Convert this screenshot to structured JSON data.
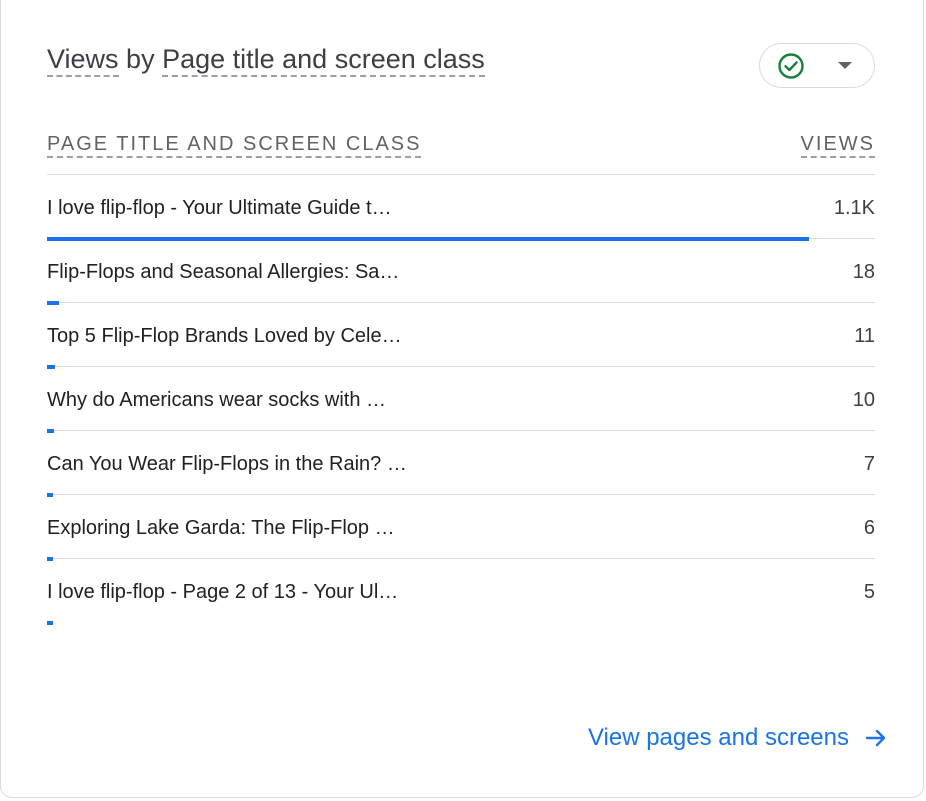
{
  "card": {
    "title_prefix": "Views",
    "title_mid": " by ",
    "title_dimension": "Page title and screen class",
    "status_icon": "check-circle-icon",
    "status_color": "#188038"
  },
  "table": {
    "col_left": "PAGE TITLE AND SCREEN CLASS",
    "col_right": "VIEWS",
    "bar_color": "#1a73e8",
    "max_views": 1100,
    "rows": [
      {
        "title": "I love flip-flop - Your Ultimate Guide t…",
        "value": "1.1K",
        "views": 1100
      },
      {
        "title": "Flip-Flops and Seasonal Allergies: Sa…",
        "value": "18",
        "views": 18
      },
      {
        "title": "Top 5 Flip-Flop Brands Loved by Cele…",
        "value": "11",
        "views": 11
      },
      {
        "title": "Why do Americans wear socks with …",
        "value": "10",
        "views": 10
      },
      {
        "title": "Can You Wear Flip-Flops in the Rain? …",
        "value": "7",
        "views": 7
      },
      {
        "title": "Exploring Lake Garda: The Flip-Flop …",
        "value": "6",
        "views": 6
      },
      {
        "title": "I love flip-flop - Page 2 of 13 - Your Ul…",
        "value": "5",
        "views": 5
      }
    ]
  },
  "footer": {
    "link_label": "View pages and screens",
    "link_icon": "arrow-right-icon"
  }
}
